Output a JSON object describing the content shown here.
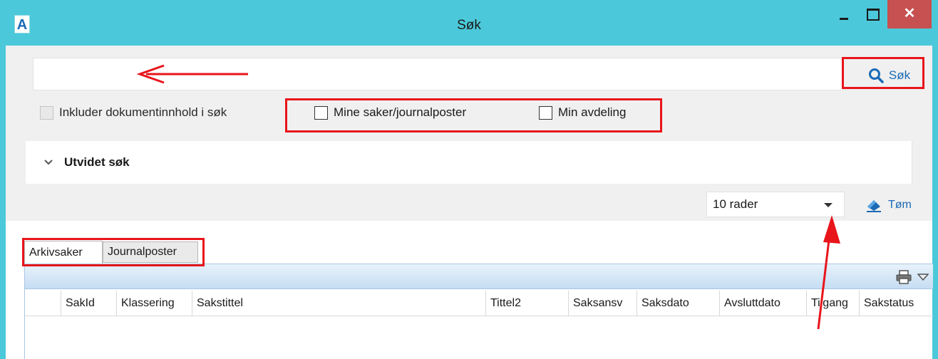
{
  "window": {
    "title": "Søk",
    "app_icon": "A",
    "close_symbol": "✕"
  },
  "search": {
    "value": "",
    "placeholder": "",
    "button_label": "Søk"
  },
  "filters": {
    "include_content": "Inkluder dokumentinnhold i søk",
    "my_cases": "Mine saker/journalposter",
    "my_department": "Min avdeling"
  },
  "advanced": {
    "label": "Utvidet søk"
  },
  "results": {
    "rows_selected": "10 rader",
    "clear_label": "Tøm"
  },
  "tabs": [
    {
      "label": "Arkivsaker",
      "active": true
    },
    {
      "label": "Journalposter",
      "active": false
    }
  ],
  "grid": {
    "columns": [
      "SakId",
      "Klassering",
      "Sakstittel",
      "Tittel2",
      "Saksansv",
      "Saksdato",
      "Avsluttdato",
      "Tilgang",
      "Sakstatus"
    ]
  },
  "colors": {
    "titlebar": "#4bc9da",
    "accent": "#1a6ab6",
    "annotation": "#e8151b",
    "close": "#c75050"
  },
  "icons": [
    "app-icon",
    "minimize-icon",
    "maximize-icon",
    "close-icon",
    "search-icon",
    "chevron-down-icon",
    "dropdown-caret-icon",
    "eraser-icon",
    "print-icon",
    "menu-caret-icon"
  ]
}
